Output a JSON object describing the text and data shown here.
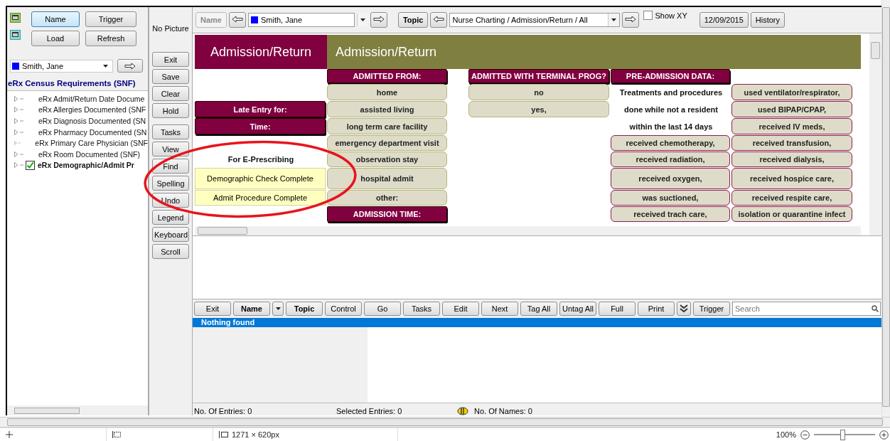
{
  "left_panel": {
    "buttons": [
      {
        "label": "Name",
        "selected": true
      },
      {
        "label": "Trigger",
        "selected": false
      },
      {
        "label": "Load",
        "selected": false
      },
      {
        "label": "Refresh",
        "selected": false
      }
    ],
    "patient": "Smith, Jane",
    "heading": "eRx Census Requirements (SNF)",
    "tree": [
      {
        "label": "eRx Admit/Return Date Docume",
        "selected": false
      },
      {
        "label": "eRx Allergies Documented (SNF",
        "selected": false
      },
      {
        "label": "eRx Diagnosis Documented (SN",
        "selected": false
      },
      {
        "label": "eRx Pharmacy Documented (SN",
        "selected": false
      },
      {
        "label": "eRx Primary Care Physician (SNF",
        "selected": false
      },
      {
        "label": "eRx Room Documented (SNF)",
        "selected": false
      },
      {
        "label": "eRx Demographic/Admit Pr",
        "selected": true,
        "checked": true
      }
    ]
  },
  "side_column": {
    "picture_label": "No Picture",
    "buttons": [
      "Exit",
      "Save",
      "Clear",
      "Hold",
      "Tasks",
      "View",
      "Find",
      "Spelling",
      "Undo",
      "Legend",
      "Keyboard",
      "Scroll"
    ]
  },
  "toolbar": {
    "name_button": "Name",
    "patient": "Smith, Jane",
    "topic_button": "Topic",
    "topic": "Nurse Charting / Admission/Return / All",
    "show_xy": {
      "label": "Show XY",
      "checked": false
    },
    "date": "12/09/2015",
    "history": "History"
  },
  "form": {
    "title": "Admission/Return",
    "subtitle": "Admission/Return",
    "rows": [
      {
        "admitted_from": {
          "text": "ADMITTED FROM:",
          "kind": "header"
        },
        "terminal_prog": {
          "text": "ADMITTED WITH TERMINAL PROG?",
          "kind": "header"
        },
        "pre_admission": {
          "text": "PRE-ADMISSION DATA:",
          "kind": "header"
        }
      },
      {
        "admitted_from": {
          "text": "home",
          "kind": "choice"
        },
        "terminal_prog": {
          "text": "no",
          "kind": "choice"
        },
        "pre_admission": {
          "text": "Treatments and procedures",
          "kind": "text"
        },
        "pre_admission_2": {
          "text": "used ventilator/respirator,",
          "kind": "item"
        }
      },
      {
        "left": {
          "text": "Late Entry for:",
          "kind": "header"
        },
        "admitted_from": {
          "text": "assisted living",
          "kind": "choice"
        },
        "terminal_prog": {
          "text": "yes,",
          "kind": "choice"
        },
        "pre_admission": {
          "text": "done while not a resident",
          "kind": "text"
        },
        "pre_admission_2": {
          "text": "used BIPAP/CPAP,",
          "kind": "item"
        }
      },
      {
        "left": {
          "text": "Time:",
          "kind": "header"
        },
        "admitted_from": {
          "text": "long term care facility",
          "kind": "choice"
        },
        "pre_admission": {
          "text": "within the last 14 days",
          "kind": "text"
        },
        "pre_admission_2": {
          "text": "received IV meds,",
          "kind": "item"
        }
      },
      {
        "admitted_from": {
          "text": "emergency department visit",
          "kind": "choice"
        },
        "pre_admission": {
          "text": "received chemotherapy,",
          "kind": "item"
        },
        "pre_admission_2": {
          "text": "received transfusion,",
          "kind": "item"
        }
      },
      {
        "left": {
          "text": "For E-Prescribing",
          "kind": "text"
        },
        "admitted_from": {
          "text": "observation stay",
          "kind": "choice"
        },
        "pre_admission": {
          "text": "received radiation,",
          "kind": "item"
        },
        "pre_admission_2": {
          "text": "received dialysis,",
          "kind": "item"
        }
      },
      {
        "left": {
          "text": "Demographic Check Complete",
          "kind": "flag"
        },
        "admitted_from": {
          "text": "hospital admit",
          "kind": "choice"
        },
        "pre_admission": {
          "text": "received oxygen,",
          "kind": "item"
        },
        "pre_admission_2": {
          "text": "received hospice care,",
          "kind": "item"
        }
      },
      {
        "left": {
          "text": "Admit Procedure Complete",
          "kind": "flag"
        },
        "admitted_from": {
          "text": "other:",
          "kind": "choice"
        },
        "pre_admission": {
          "text": "was suctioned,",
          "kind": "item"
        },
        "pre_admission_2": {
          "text": "received respite care,",
          "kind": "item"
        }
      },
      {
        "admitted_from": {
          "text": "ADMISSION TIME:",
          "kind": "header"
        },
        "pre_admission": {
          "text": "received trach care,",
          "kind": "item"
        },
        "pre_admission_2": {
          "text": "isolation or quarantine infect",
          "kind": "item"
        }
      }
    ]
  },
  "bottom_toolbar": {
    "buttons": [
      {
        "label": "Exit",
        "kind": "plain"
      },
      {
        "label": "Name",
        "kind": "bold"
      },
      {
        "kind": "dropdown"
      },
      {
        "label": "Topic",
        "kind": "bold"
      },
      {
        "label": "Control",
        "kind": "plain"
      },
      {
        "label": "Go",
        "kind": "plain"
      },
      {
        "label": "Tasks",
        "kind": "plain"
      },
      {
        "label": "Edit",
        "kind": "plain"
      },
      {
        "label": "Next",
        "kind": "plain"
      },
      {
        "label": "Tag All",
        "kind": "plain"
      },
      {
        "label": "Untag All",
        "kind": "plain"
      },
      {
        "label": "Full",
        "kind": "plain"
      },
      {
        "label": "Print",
        "kind": "plain"
      },
      {
        "kind": "chevrons"
      },
      {
        "label": "Trigger",
        "kind": "plain"
      }
    ],
    "search": {
      "placeholder": "Search"
    }
  },
  "results": {
    "rows": [
      {
        "text": "Nothing found",
        "selected": true
      }
    ]
  },
  "status": {
    "entries": "No. Of Entries: 0",
    "selected": "Selected Entries: 0",
    "names": "No. Of Names: 0"
  },
  "viewer_status": {
    "dimensions": "1271 × 620px",
    "zoom": "100%",
    "zoom_slider": {
      "level": 0.47
    }
  }
}
